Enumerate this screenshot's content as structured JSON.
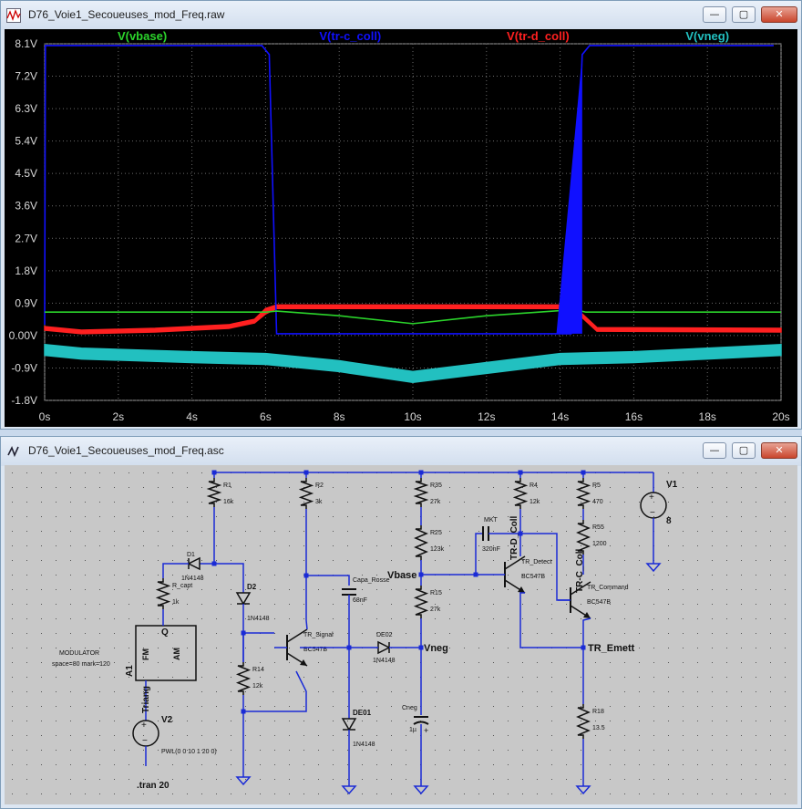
{
  "plot_window": {
    "title": "D76_Voie1_Secoueuses_mod_Freq.raw",
    "buttons": {
      "minimize": "—",
      "maximize": "▢",
      "close": "✕"
    }
  },
  "schematic_window": {
    "title": "D76_Voie1_Secoueuses_mod_Freq.asc",
    "buttons": {
      "minimize": "—",
      "maximize": "▢",
      "close": "✕"
    }
  },
  "chart_data": {
    "type": "line",
    "title": "",
    "xlabel": "",
    "ylabel": "",
    "xlim": [
      0,
      20
    ],
    "ylim": [
      -1.8,
      8.1
    ],
    "x_ticks": [
      "0s",
      "2s",
      "4s",
      "6s",
      "8s",
      "10s",
      "12s",
      "14s",
      "16s",
      "18s",
      "20s"
    ],
    "y_ticks": [
      "8.1V",
      "7.2V",
      "6.3V",
      "5.4V",
      "4.5V",
      "3.6V",
      "2.7V",
      "1.8V",
      "0.9V",
      "0.00V",
      "-0.9V",
      "-1.8V"
    ],
    "y_tick_values": [
      8.1,
      7.2,
      6.3,
      5.4,
      4.5,
      3.6,
      2.7,
      1.8,
      0.9,
      0.0,
      -0.9,
      -1.8
    ],
    "x_tick_values": [
      0,
      2,
      4,
      6,
      8,
      10,
      12,
      14,
      16,
      18,
      20
    ],
    "grid": true,
    "legend_placement": "top",
    "series": [
      {
        "name": "V(vbase)",
        "color": "#2bd42b",
        "x": [
          0,
          6,
          6.3,
          8,
          10,
          12,
          14.4,
          14.7,
          20
        ],
        "y": [
          0.65,
          0.65,
          0.68,
          0.55,
          0.33,
          0.55,
          0.72,
          0.65,
          0.65
        ]
      },
      {
        "name": "V(tr-c_coll)",
        "color": "#1010ff",
        "x": [
          0,
          0.02,
          5.9,
          6.1,
          6.3,
          14.3,
          14.6,
          14.8,
          19.8
        ],
        "y": [
          0.3,
          8.05,
          8.05,
          7.8,
          0.05,
          0.05,
          7.8,
          8.05,
          8.05
        ]
      },
      {
        "name": "V(tr-d_coll)",
        "color": "#ff2020",
        "x": [
          0,
          1,
          3,
          5,
          5.7,
          6.0,
          6.3,
          10,
          14.3,
          14.6,
          15,
          20
        ],
        "y": [
          0.15,
          0.05,
          0.1,
          0.2,
          0.35,
          0.6,
          0.75,
          0.75,
          0.75,
          0.5,
          0.12,
          0.1
        ],
        "y_upper": [
          0.25,
          0.15,
          0.2,
          0.3,
          0.45,
          0.75,
          0.85,
          0.85,
          0.85,
          0.6,
          0.22,
          0.2
        ]
      },
      {
        "name": "V(vneg)",
        "color": "#22c0c0",
        "x": [
          0,
          1,
          4,
          6,
          8,
          10,
          12,
          14,
          16,
          18,
          20
        ],
        "y": [
          -0.25,
          -0.35,
          -0.45,
          -0.5,
          -0.7,
          -1.0,
          -0.75,
          -0.5,
          -0.45,
          -0.35,
          -0.25
        ],
        "y_lower": [
          -0.55,
          -0.65,
          -0.75,
          -0.8,
          -1.0,
          -1.3,
          -1.05,
          -0.8,
          -0.75,
          -0.65,
          -0.55
        ]
      }
    ]
  },
  "schematic": {
    "components": [
      "R1",
      "16k",
      "D1",
      "1N4148",
      "R2",
      "3k",
      "D2",
      "1N4148",
      "R_capt",
      "1k",
      "R14",
      "12k",
      "TR_Signal",
      "BC547B",
      "Capa_Rosse",
      "68nF",
      "DE02",
      "1N4148",
      "DE01",
      "1N4148",
      "R35",
      "27k",
      "R25",
      "123k",
      "R15",
      "27k",
      "Cneg",
      "1µ",
      "MKT",
      "320nF",
      "R4",
      "12k",
      "TR_Detect",
      "BC547B",
      "R5",
      "470",
      "R55",
      "1200",
      "TR_Command",
      "BC547B",
      "R18",
      "13.5",
      "V1",
      "8",
      "V2"
    ],
    "net_labels": [
      "TR-D_Coll",
      "TR-C_Coll",
      "Vbase",
      "Vneg",
      "TR_Emett"
    ],
    "modulator_label": "MODULATOR",
    "modulator_params": "space=80 mark=120",
    "modulator_pins": [
      "Q",
      "FM",
      "AM",
      "A1"
    ],
    "triang": "Triang",
    "pwl": "PWL(0 0 10 1 20 0)",
    "tran": ".tran 20",
    "cap_plus": "+"
  }
}
